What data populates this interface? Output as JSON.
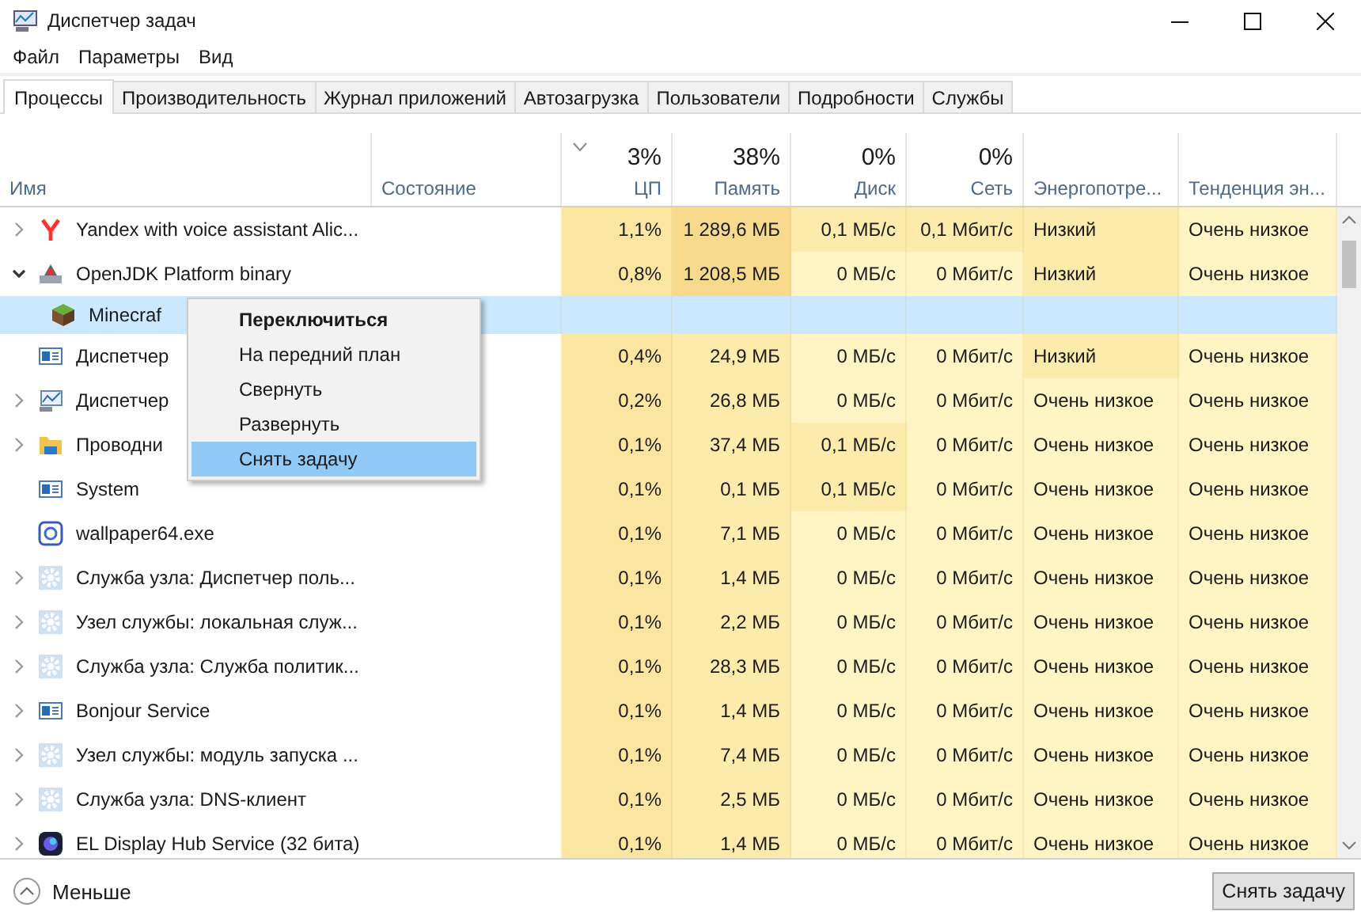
{
  "window": {
    "title": "Диспетчер задач"
  },
  "menu": [
    "Файл",
    "Параметры",
    "Вид"
  ],
  "tabs": [
    {
      "label": "Процессы",
      "selected": true
    },
    {
      "label": "Производительность",
      "selected": false
    },
    {
      "label": "Журнал приложений",
      "selected": false
    },
    {
      "label": "Автозагрузка",
      "selected": false
    },
    {
      "label": "Пользователи",
      "selected": false
    },
    {
      "label": "Подробности",
      "selected": false
    },
    {
      "label": "Службы",
      "selected": false
    }
  ],
  "columns": [
    {
      "label": "Имя",
      "sorted": false
    },
    {
      "label": "Состояние",
      "sorted": false
    },
    {
      "label": "ЦП",
      "value": "3%",
      "sorted": true
    },
    {
      "label": "Память",
      "value": "38%",
      "sorted": false
    },
    {
      "label": "Диск",
      "value": "0%",
      "sorted": false
    },
    {
      "label": "Сеть",
      "value": "0%",
      "sorted": false
    },
    {
      "label": "Энергопотре...",
      "sorted": false
    },
    {
      "label": "Тенденция эн...",
      "sorted": false
    }
  ],
  "rows": [
    {
      "name": "Yandex with voice assistant Alic...",
      "kind": "yandex",
      "expandable": true,
      "expanded": false,
      "selected": false,
      "cells": [
        {
          "text": "1,1%",
          "color": "#fae6a0"
        },
        {
          "text": "1 289,6 МБ",
          "color": "#f8da8c"
        },
        {
          "text": "0,1 МБ/с",
          "color": "#fcebab"
        },
        {
          "text": "0,1 Мбит/с",
          "color": "#fcebab"
        },
        {
          "text": "Низкий",
          "color": "#fcebab"
        },
        {
          "text": "Очень низкое",
          "color": "#fff4c4"
        }
      ]
    },
    {
      "name": "OpenJDK Platform binary",
      "kind": "java",
      "expandable": true,
      "expanded": true,
      "selected": false,
      "cells": [
        {
          "text": "0,8%",
          "color": "#fae6a0"
        },
        {
          "text": "1 208,5 МБ",
          "color": "#f8da8c"
        },
        {
          "text": "0 МБ/с",
          "color": "#fff4c4"
        },
        {
          "text": "0 Мбит/с",
          "color": "#fff4c4"
        },
        {
          "text": "Низкий",
          "color": "#fcebab"
        },
        {
          "text": "Очень низкое",
          "color": "#fff4c4"
        }
      ],
      "children": [
        {
          "name": "Minecraf",
          "kind": "game",
          "expandable": false,
          "selected": true
        }
      ]
    },
    {
      "name": "Диспетчер",
      "kind": "window",
      "expandable": false,
      "selected": false,
      "cells": [
        {
          "text": "0,4%",
          "color": "#fae6a0"
        },
        {
          "text": "24,9 МБ",
          "color": "#fcebab"
        },
        {
          "text": "0 МБ/с",
          "color": "#fff4c4"
        },
        {
          "text": "0 Мбит/с",
          "color": "#fff4c4"
        },
        {
          "text": "Низкий",
          "color": "#fcebab"
        },
        {
          "text": "Очень низкое",
          "color": "#fff4c4"
        }
      ]
    },
    {
      "name": "Диспетчер",
      "kind": "monitor",
      "expandable": true,
      "expanded": false,
      "selected": false,
      "cells": [
        {
          "text": "0,2%",
          "color": "#fae6a0"
        },
        {
          "text": "26,8 МБ",
          "color": "#fcebab"
        },
        {
          "text": "0 МБ/с",
          "color": "#fff4c4"
        },
        {
          "text": "0 Мбит/с",
          "color": "#fff4c4"
        },
        {
          "text": "Очень низкое",
          "color": "#fff4c4"
        },
        {
          "text": "Очень низкое",
          "color": "#fff4c4"
        }
      ]
    },
    {
      "name": "Проводни",
      "kind": "folder",
      "expandable": true,
      "expanded": false,
      "selected": false,
      "cells": [
        {
          "text": "0,1%",
          "color": "#fae6a0"
        },
        {
          "text": "37,4 МБ",
          "color": "#fcebab"
        },
        {
          "text": "0,1 МБ/с",
          "color": "#fcebab"
        },
        {
          "text": "0 Мбит/с",
          "color": "#fff4c4"
        },
        {
          "text": "Очень низкое",
          "color": "#fff4c4"
        },
        {
          "text": "Очень низкое",
          "color": "#fff4c4"
        }
      ]
    },
    {
      "name": "System",
      "kind": "window",
      "expandable": false,
      "selected": false,
      "cells": [
        {
          "text": "0,1%",
          "color": "#fae6a0"
        },
        {
          "text": "0,1 МБ",
          "color": "#fcebab"
        },
        {
          "text": "0,1 МБ/с",
          "color": "#fcebab"
        },
        {
          "text": "0 Мбит/с",
          "color": "#fff4c4"
        },
        {
          "text": "Очень низкое",
          "color": "#fff4c4"
        },
        {
          "text": "Очень низкое",
          "color": "#fff4c4"
        }
      ]
    },
    {
      "name": "wallpaper64.exe",
      "kind": "wallpaper",
      "expandable": false,
      "selected": false,
      "cells": [
        {
          "text": "0,1%",
          "color": "#fae6a0"
        },
        {
          "text": "7,1 МБ",
          "color": "#fcebab"
        },
        {
          "text": "0 МБ/с",
          "color": "#fff4c4"
        },
        {
          "text": "0 Мбит/с",
          "color": "#fff4c4"
        },
        {
          "text": "Очень низкое",
          "color": "#fff4c4"
        },
        {
          "text": "Очень низкое",
          "color": "#fff4c4"
        }
      ]
    },
    {
      "name": "Служба узла: Диспетчер поль...",
      "kind": "service",
      "expandable": true,
      "expanded": false,
      "selected": false,
      "cells": [
        {
          "text": "0,1%",
          "color": "#fae6a0"
        },
        {
          "text": "1,4 МБ",
          "color": "#fcebab"
        },
        {
          "text": "0 МБ/с",
          "color": "#fff4c4"
        },
        {
          "text": "0 Мбит/с",
          "color": "#fff4c4"
        },
        {
          "text": "Очень низкое",
          "color": "#fff4c4"
        },
        {
          "text": "Очень низкое",
          "color": "#fff4c4"
        }
      ]
    },
    {
      "name": "Узел службы: локальная служ...",
      "kind": "service",
      "expandable": true,
      "expanded": false,
      "selected": false,
      "cells": [
        {
          "text": "0,1%",
          "color": "#fae6a0"
        },
        {
          "text": "2,2 МБ",
          "color": "#fcebab"
        },
        {
          "text": "0 МБ/с",
          "color": "#fff4c4"
        },
        {
          "text": "0 Мбит/с",
          "color": "#fff4c4"
        },
        {
          "text": "Очень низкое",
          "color": "#fff4c4"
        },
        {
          "text": "Очень низкое",
          "color": "#fff4c4"
        }
      ]
    },
    {
      "name": "Служба узла: Служба политик...",
      "kind": "service",
      "expandable": true,
      "expanded": false,
      "selected": false,
      "cells": [
        {
          "text": "0,1%",
          "color": "#fae6a0"
        },
        {
          "text": "28,3 МБ",
          "color": "#fcebab"
        },
        {
          "text": "0 МБ/с",
          "color": "#fff4c4"
        },
        {
          "text": "0 Мбит/с",
          "color": "#fff4c4"
        },
        {
          "text": "Очень низкое",
          "color": "#fff4c4"
        },
        {
          "text": "Очень низкое",
          "color": "#fff4c4"
        }
      ]
    },
    {
      "name": "Bonjour Service",
      "kind": "window",
      "expandable": true,
      "expanded": false,
      "selected": false,
      "cells": [
        {
          "text": "0,1%",
          "color": "#fae6a0"
        },
        {
          "text": "1,4 МБ",
          "color": "#fcebab"
        },
        {
          "text": "0 МБ/с",
          "color": "#fff4c4"
        },
        {
          "text": "0 Мбит/с",
          "color": "#fff4c4"
        },
        {
          "text": "Очень низкое",
          "color": "#fff4c4"
        },
        {
          "text": "Очень низкое",
          "color": "#fff4c4"
        }
      ]
    },
    {
      "name": "Узел службы: модуль запуска ...",
      "kind": "service",
      "expandable": true,
      "expanded": false,
      "selected": false,
      "cells": [
        {
          "text": "0,1%",
          "color": "#fae6a0"
        },
        {
          "text": "7,4 МБ",
          "color": "#fcebab"
        },
        {
          "text": "0 МБ/с",
          "color": "#fff4c4"
        },
        {
          "text": "0 Мбит/с",
          "color": "#fff4c4"
        },
        {
          "text": "Очень низкое",
          "color": "#fff4c4"
        },
        {
          "text": "Очень низкое",
          "color": "#fff4c4"
        }
      ]
    },
    {
      "name": "Служба узла: DNS-клиент",
      "kind": "service",
      "expandable": true,
      "expanded": false,
      "selected": false,
      "cells": [
        {
          "text": "0,1%",
          "color": "#fae6a0"
        },
        {
          "text": "2,5 МБ",
          "color": "#fcebab"
        },
        {
          "text": "0 МБ/с",
          "color": "#fff4c4"
        },
        {
          "text": "0 Мбит/с",
          "color": "#fff4c4"
        },
        {
          "text": "Очень низкое",
          "color": "#fff4c4"
        },
        {
          "text": "Очень низкое",
          "color": "#fff4c4"
        }
      ]
    },
    {
      "name": "EL Display Hub Service (32 бита)",
      "kind": "app",
      "expandable": true,
      "expanded": false,
      "selected": false,
      "cells": [
        {
          "text": "0,1%",
          "color": "#fae6a0"
        },
        {
          "text": "1,4 МБ",
          "color": "#fcebab"
        },
        {
          "text": "0 МБ/с",
          "color": "#fff4c4"
        },
        {
          "text": "0 Мбит/с",
          "color": "#fff4c4"
        },
        {
          "text": "Очень низкое",
          "color": "#fff4c4"
        },
        {
          "text": "Очень низкое",
          "color": "#fff4c4"
        }
      ]
    }
  ],
  "context_menu": [
    {
      "label": "Переключиться",
      "default": true,
      "selected": false
    },
    {
      "label": "На передний план",
      "default": false,
      "selected": false
    },
    {
      "label": "Свернуть",
      "default": false,
      "selected": false
    },
    {
      "label": "Развернуть",
      "default": false,
      "selected": false
    },
    {
      "label": "Снять задачу",
      "default": false,
      "selected": true
    }
  ],
  "footer": {
    "toggle": "Меньше",
    "button": "Снять задачу"
  }
}
